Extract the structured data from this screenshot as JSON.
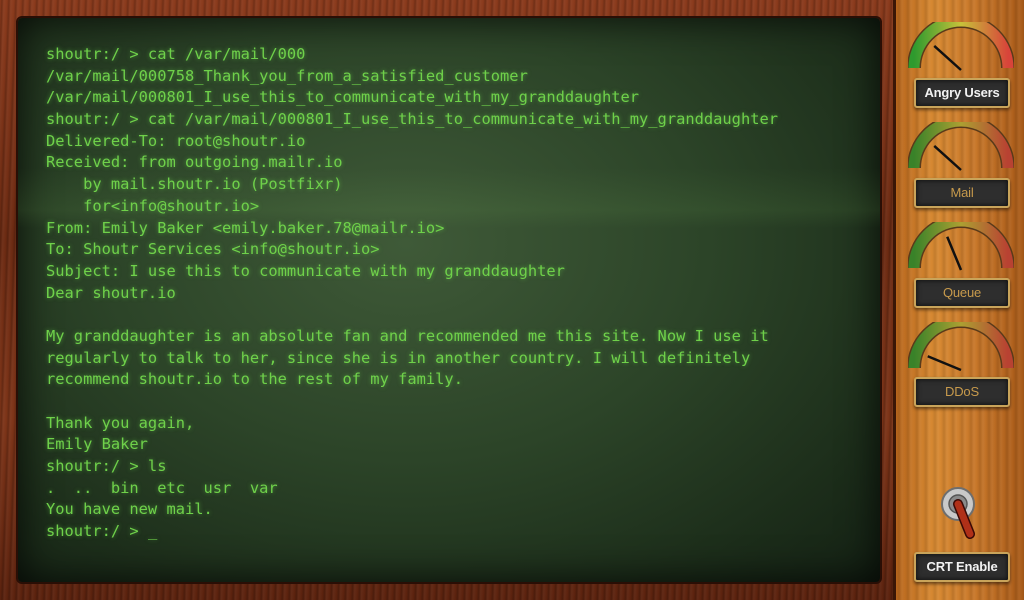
{
  "terminal": {
    "lines": [
      "shoutr:/ > cat /var/mail/000",
      "/var/mail/000758_Thank_you_from_a_satisfied_customer",
      "/var/mail/000801_I_use_this_to_communicate_with_my_granddaughter",
      "shoutr:/ > cat /var/mail/000801_I_use_this_to_communicate_with_my_granddaughter",
      "Delivered-To: root@shoutr.io",
      "Received: from outgoing.mailr.io",
      "    by mail.shoutr.io (Postfixr)",
      "    for<info@shoutr.io>",
      "From: Emily Baker <emily.baker.78@mailr.io>",
      "To: Shoutr Services <info@shoutr.io>",
      "Subject: I use this to communicate with my granddaughter",
      "Dear shoutr.io",
      "",
      "My granddaughter is an absolute fan and recommended me this site. Now I use it",
      "regularly to talk to her, since she is in another country. I will definitely",
      "recommend shoutr.io to the rest of my family.",
      "",
      "Thank you again,",
      "Emily Baker",
      "shoutr:/ > ls",
      ".  ..  bin  etc  usr  var",
      "You have new mail."
    ],
    "prompt": "shoutr:/ > ",
    "cursor": "_",
    "color": "#6fd14a"
  },
  "panel": {
    "gauges": [
      {
        "label": "Angry Users",
        "level": 0.18,
        "active": true
      },
      {
        "label": "Mail",
        "level": 0.18,
        "active": false
      },
      {
        "label": "Queue",
        "level": 0.35,
        "active": false
      },
      {
        "label": "DDoS",
        "level": 0.05,
        "active": false
      }
    ],
    "toggle": {
      "label": "CRT Enable",
      "state": "on"
    }
  }
}
